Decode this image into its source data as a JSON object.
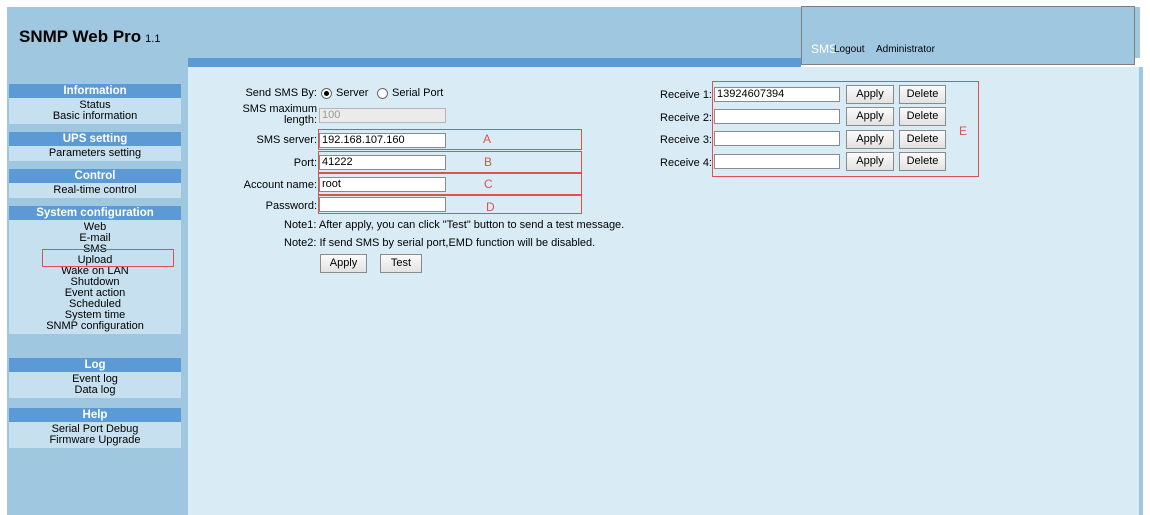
{
  "header": {
    "title": "SNMP Web Pro",
    "version": "1.1",
    "sms_link": "SMS",
    "logout": "Logout",
    "user": "Administrator"
  },
  "sidebar": {
    "sections": [
      {
        "title": "Information",
        "items": [
          "Status",
          "Basic information"
        ]
      },
      {
        "title": "UPS setting",
        "items": [
          "Parameters setting"
        ]
      },
      {
        "title": "Control",
        "items": [
          "Real-time control"
        ]
      },
      {
        "title": "System configuration",
        "items": [
          "Web",
          "E-mail",
          "SMS",
          "Upload",
          "Wake on LAN",
          "Shutdown",
          "Event action",
          "Scheduled",
          "System time",
          "SNMP configuration"
        ]
      },
      {
        "title": "Log",
        "items": [
          "Event log",
          "Data log"
        ]
      },
      {
        "title": "Help",
        "items": [
          "Serial Port Debug",
          "Firmware Upgrade"
        ]
      }
    ],
    "active_item": "SMS"
  },
  "form": {
    "send_by_label": "Send SMS By:",
    "option_server": "Server",
    "option_serial": "Serial Port",
    "selected_option": "Server",
    "max_length_label_1": "SMS maximum",
    "max_length_label_2": "length:",
    "max_length_value": "100",
    "server_label": "SMS server:",
    "server_value": "192.168.107.160",
    "port_label": "Port:",
    "port_value": "41222",
    "account_label": "Account name:",
    "account_value": "root",
    "password_label": "Password:",
    "password_value": "",
    "note1": "Note1: After apply, you can click \"Test\" button to send a test message.",
    "note2": "Note2: If send SMS by serial port,EMD function will be disabled.",
    "apply_label": "Apply",
    "test_label": "Test"
  },
  "receivers": [
    {
      "label": "Receive 1:",
      "value": "13924607394",
      "apply": "Apply",
      "delete": "Delete"
    },
    {
      "label": "Receive 2:",
      "value": "",
      "apply": "Apply",
      "delete": "Delete"
    },
    {
      "label": "Receive 3:",
      "value": "",
      "apply": "Apply",
      "delete": "Delete"
    },
    {
      "label": "Receive 4:",
      "value": "",
      "apply": "Apply",
      "delete": "Delete"
    }
  ],
  "annotations": {
    "a": "A",
    "b": "B",
    "c": "C",
    "d": "D",
    "e": "E"
  },
  "colors": {
    "header_bg": "#9fc8e0",
    "section_head": "#5c9ad6",
    "main_bg": "#d9ecf5",
    "annotation_red": "#e05050"
  }
}
